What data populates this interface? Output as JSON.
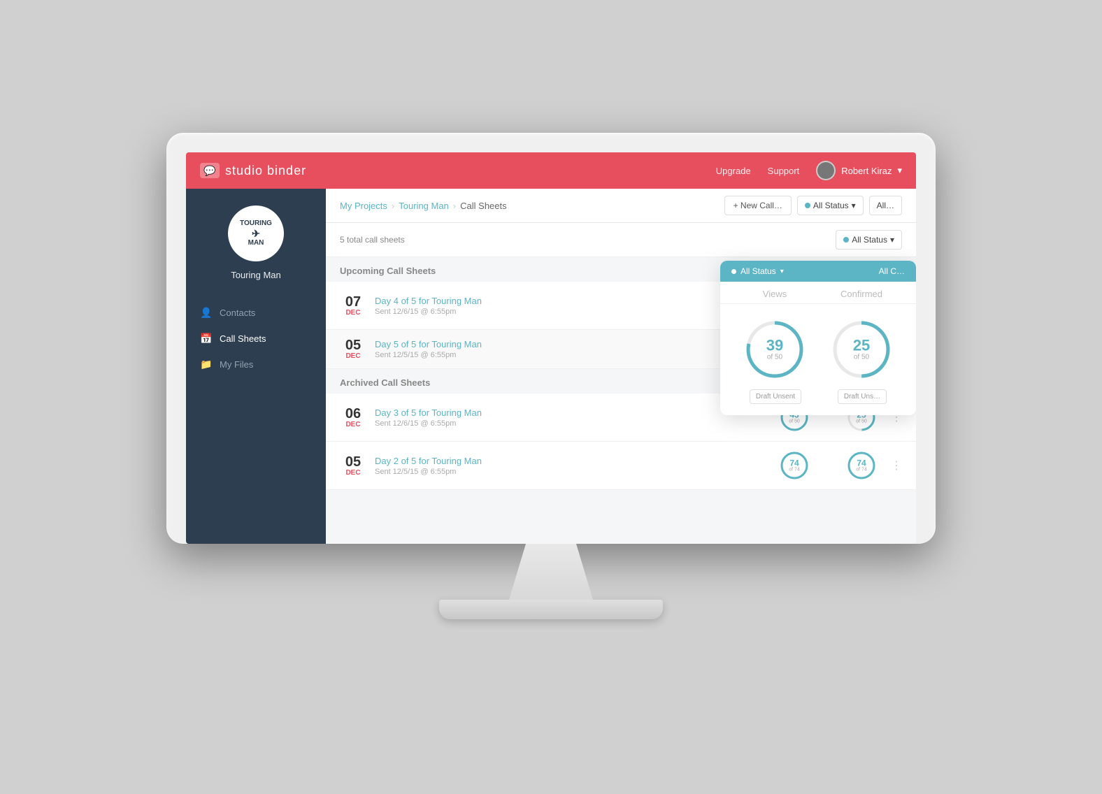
{
  "brand": {
    "name": "studio binder",
    "icon": "💬"
  },
  "nav": {
    "upgrade_label": "Upgrade",
    "support_label": "Support",
    "user_name": "Robert Kiraz",
    "user_chevron": "▾"
  },
  "sidebar": {
    "project_name": "Touring Man",
    "project_logo_line1": "TOURING",
    "project_logo_line2": "✈",
    "project_logo_line3": "MAN",
    "items": [
      {
        "label": "Contacts",
        "icon": "👤",
        "active": false
      },
      {
        "label": "Call Sheets",
        "icon": "📅",
        "active": true
      },
      {
        "label": "My Files",
        "icon": "📁",
        "active": false
      }
    ]
  },
  "breadcrumb": {
    "my_projects": "My Projects",
    "project": "Touring Man",
    "current": "Call Sheets"
  },
  "toolbar": {
    "new_call_label": "+ New Call…",
    "status_label": "All Status",
    "status_chevron": "▾",
    "all_chevron": "All…"
  },
  "list_summary": {
    "total": "5 total call sheets",
    "status_label": "All Status",
    "status_chevron": "▾"
  },
  "columns": {
    "views": "Views",
    "confirmed": "Confirmed"
  },
  "upcoming_section": "Upcoming Call Sheets",
  "archived_section": "Archived Call Sheets",
  "call_sheets": [
    {
      "id": 1,
      "day_num": "07",
      "month": "DEC",
      "title": "Day 4 of 5 for Touring Man",
      "subtitle": "Sent 12/6/15 @ 6:55pm",
      "views_num": 39,
      "views_total": 50,
      "views_pct": 78,
      "confirmed_num": 25,
      "confirmed_total": 50,
      "confirmed_pct": 50,
      "section": "upcoming",
      "show_draft": false
    },
    {
      "id": 2,
      "day_num": "05",
      "month": "DEC",
      "title": "Day 5 of 5 for Touring Man",
      "subtitle": "Sent 12/5/15 @ 6:55pm",
      "views_num": null,
      "views_total": null,
      "views_pct": null,
      "confirmed_num": null,
      "confirmed_total": null,
      "confirmed_pct": null,
      "section": "upcoming",
      "show_draft": true,
      "draft_label": "Draft Unsent"
    },
    {
      "id": 3,
      "day_num": "06",
      "month": "DEC",
      "title": "Day 3 of 5 for Touring Man",
      "subtitle": "Sent 12/6/15 @ 6:55pm",
      "views_num": 43,
      "views_total": 50,
      "views_pct": 86,
      "confirmed_num": 25,
      "confirmed_total": 50,
      "confirmed_pct": 50,
      "section": "archived",
      "show_draft": false
    },
    {
      "id": 4,
      "day_num": "05",
      "month": "DEC",
      "title": "Day 2 of 5 for Touring Man",
      "subtitle": "Sent 12/5/15 @ 6:55pm",
      "views_num": 74,
      "views_total": 74,
      "views_pct": 100,
      "confirmed_num": 74,
      "confirmed_total": 74,
      "confirmed_pct": 100,
      "section": "archived",
      "show_draft": false
    }
  ],
  "tooltip": {
    "views_label": "Views",
    "confirmed_label": "Confirmed",
    "views_num": "39",
    "views_denom": "of 50",
    "confirmed_num": "25",
    "confirmed_denom": "of 50",
    "draft_label1": "Draft Unsent",
    "draft_label2": "Draft Uns…"
  },
  "zoom": {
    "views_num": "39",
    "views_denom": "of 50",
    "confirmed_num": "25",
    "confirmed_denom": "of 50"
  }
}
